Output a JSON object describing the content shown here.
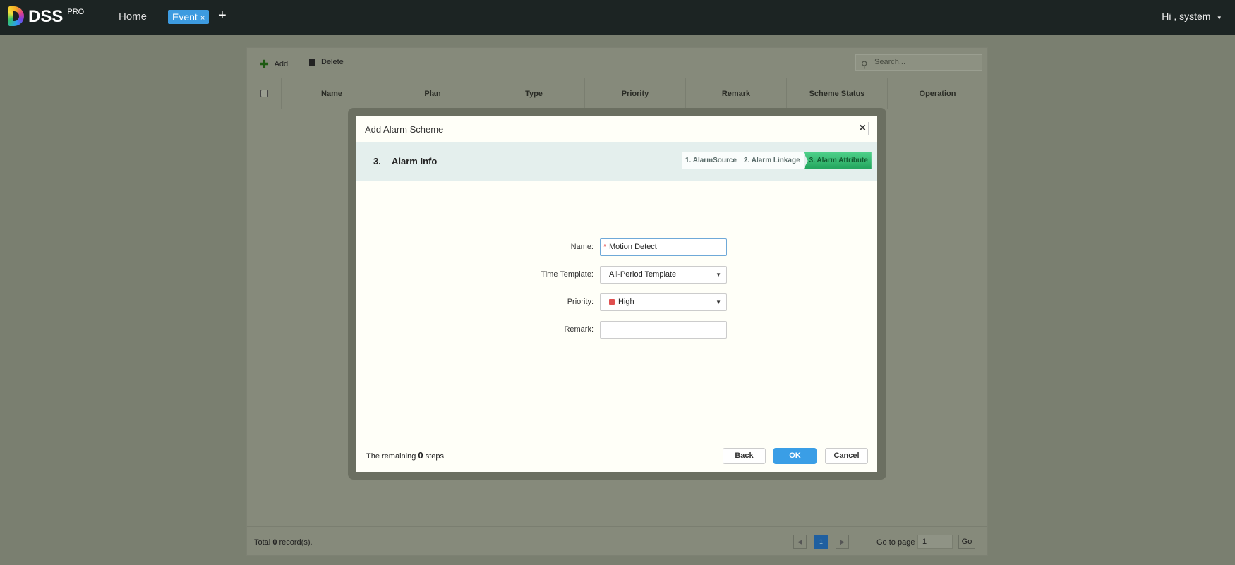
{
  "topbar": {
    "logo": "DSS",
    "logo_sup": "PRO",
    "home": "Home",
    "tab": "Event",
    "tab_close": "×",
    "add_tab": "+",
    "user": "Hi , system",
    "user_caret": "▾"
  },
  "toolbar": {
    "add": "Add",
    "delete": "Delete",
    "search_placeholder": "Search..."
  },
  "table": {
    "columns": [
      "Name",
      "Plan",
      "Type",
      "Priority",
      "Remark",
      "Scheme Status",
      "Operation"
    ]
  },
  "pagination": {
    "total_prefix": "Total",
    "total": "0",
    "total_suffix": "record(s).",
    "prev": "◀",
    "page": "1",
    "next": "▶",
    "goto_label": "Go to page",
    "goto_value": "1",
    "go": "Go"
  },
  "dialog": {
    "title": "Add Alarm Scheme",
    "close": "×",
    "step_num": "3.",
    "step_title": "Alarm Info",
    "steps": [
      "1. AlarmSource",
      "2. Alarm Linkage",
      "3. Alarm Attribute"
    ],
    "form": {
      "name_label": "Name:",
      "name_value": "Motion Detect",
      "required_mark": "*",
      "time_label": "Time Template:",
      "time_value": "All-Period Template",
      "priority_label": "Priority:",
      "priority_value": "High",
      "priority_color": "#e04f4f",
      "remark_label": "Remark:",
      "remark_value": "",
      "caret": "▼"
    },
    "remaining_prefix": "The remaining",
    "remaining": "0",
    "remaining_suffix": "steps",
    "back": "Back",
    "ok": "OK",
    "cancel": "Cancel"
  }
}
